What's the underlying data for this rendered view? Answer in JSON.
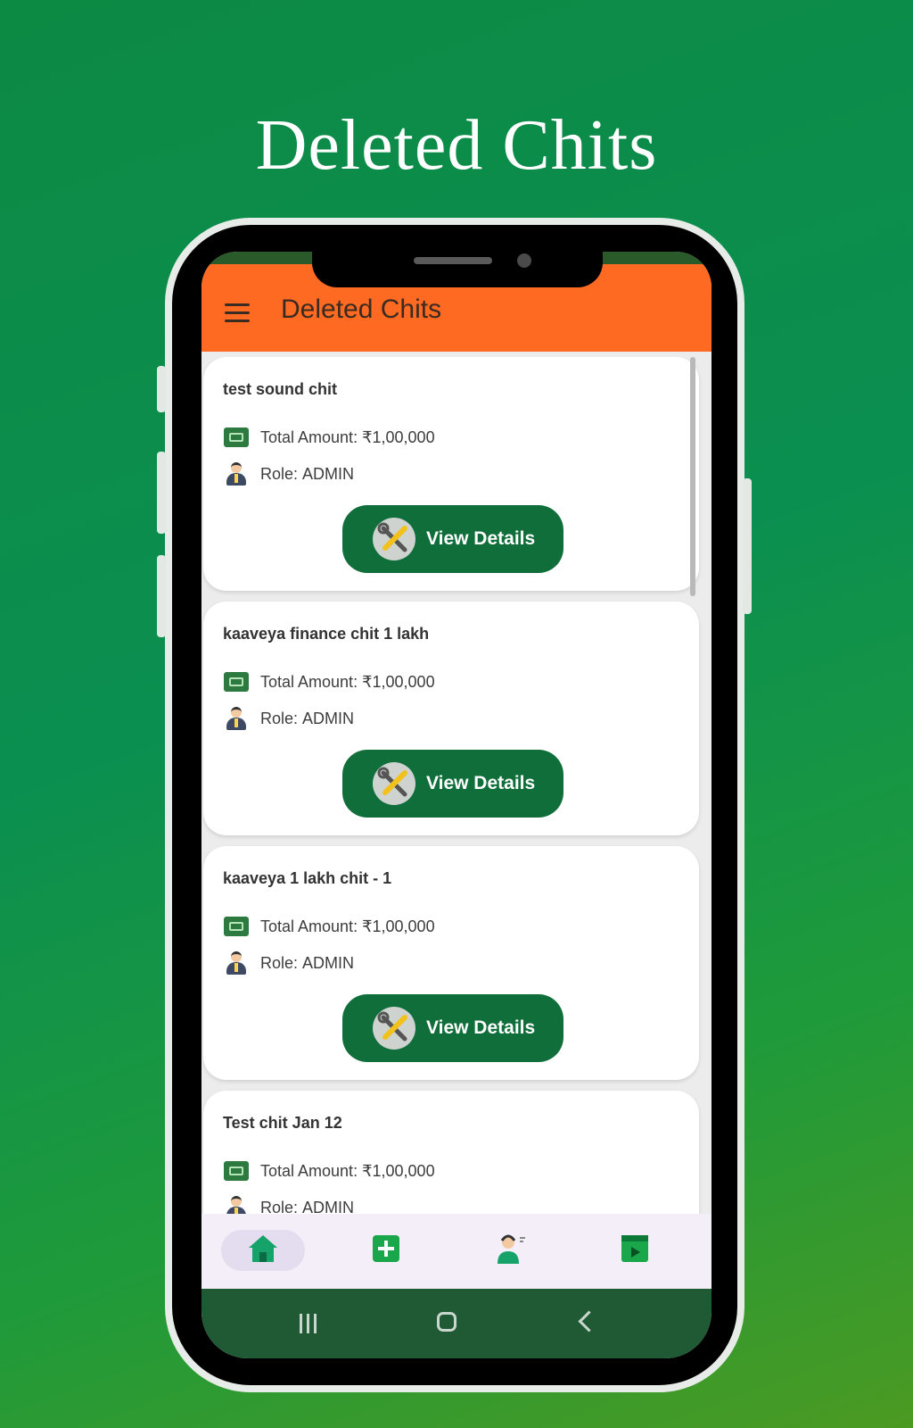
{
  "promo": {
    "headline": "Deleted Chits"
  },
  "appbar": {
    "title": "Deleted Chits",
    "menu_icon": "hamburger-menu-icon"
  },
  "labels": {
    "total_amount": "Total Amount: ₹1,00,000",
    "role_prefix": "Role: ",
    "view_details": "View Details"
  },
  "chits": [
    {
      "name": "test sound chit",
      "role": "ADMIN"
    },
    {
      "name": "kaaveya finance chit 1 lakh",
      "role": "ADMIN"
    },
    {
      "name": "kaaveya 1 lakh chit - 1",
      "role": "ADMIN"
    },
    {
      "name": "Test chit Jan 12",
      "role": "ADMIN"
    }
  ],
  "bottom_nav": [
    {
      "icon": "home-icon",
      "active": true
    },
    {
      "icon": "add-icon",
      "active": false
    },
    {
      "icon": "support-agent-icon",
      "active": false
    },
    {
      "icon": "video-icon",
      "active": false
    }
  ],
  "system_nav": [
    "recents-icon",
    "home-circle-icon",
    "back-icon"
  ],
  "colors": {
    "appbar": "#ff6a23",
    "button": "#0f6e3a",
    "role_value": "#f07a2a",
    "background_gradient_start": "#0c8a44",
    "background_gradient_end": "#4b9a22"
  }
}
